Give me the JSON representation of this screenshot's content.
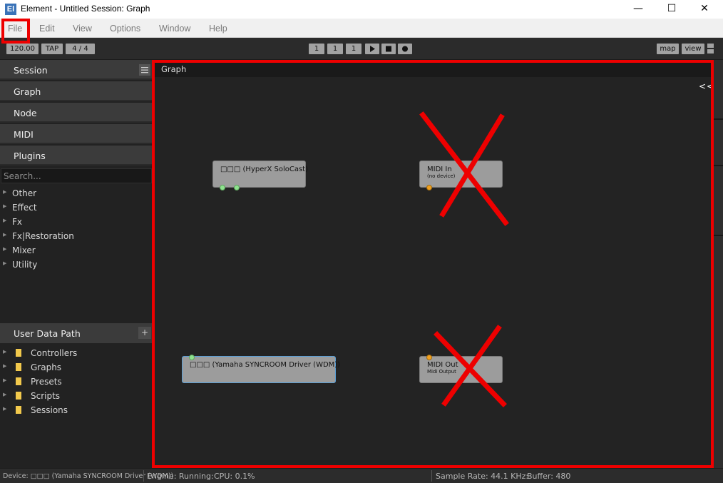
{
  "window": {
    "icon_text": "El",
    "title": "Element - Untitled Session: Graph",
    "minimize_glyph": "—",
    "maximize_glyph": "☐",
    "close_glyph": "✕"
  },
  "menu": [
    "File",
    "Edit",
    "View",
    "Options",
    "Window",
    "Help"
  ],
  "toolbar": {
    "tempo": "120.00",
    "tap": "TAP",
    "time_signature": "4 / 4",
    "position": [
      "1",
      "1",
      "1"
    ],
    "play_icon": "play-icon",
    "stop_icon": "stop-icon",
    "record_icon": "record-icon",
    "map": "map",
    "view": "view"
  },
  "sidebar": {
    "headers": [
      "Session",
      "Graph",
      "Node",
      "MIDI",
      "Plugins"
    ],
    "search_placeholder": "Search...",
    "categories": [
      "Other",
      "Effect",
      "Fx",
      "Fx|Restoration",
      "Mixer",
      "Utility"
    ],
    "user_data_path": {
      "title": "User Data Path",
      "add": "+",
      "folders": [
        "Controllers",
        "Graphs",
        "Presets",
        "Scripts",
        "Sessions"
      ]
    }
  },
  "graph": {
    "title": "Graph",
    "collapse": "<<",
    "nodes": [
      {
        "name": "□□□ (HyperX SoloCast)",
        "subtitle": ""
      },
      {
        "name": "MIDI In",
        "subtitle": "(no device)"
      },
      {
        "name": "□□□ (Yamaha SYNCROOM Driver (WDM))",
        "subtitle": ""
      },
      {
        "name": "MIDI Out",
        "subtitle": "Midi Output"
      }
    ]
  },
  "status": {
    "device": "Device: □□□ (Yamaha SYNCROOM Driver (WDM))",
    "engine": "Engine: Running:",
    "cpu": "CPU: 0.1%",
    "sample_rate": "Sample Rate: 44.1 KHz:",
    "buffer": "Buffer: 480"
  },
  "colors": {
    "annotation": "#ee0000",
    "audio_port": "#8fe38f",
    "midi_port": "#f0a020",
    "node": "#9c9c9c",
    "selected_node_border": "#5a9fd6"
  }
}
